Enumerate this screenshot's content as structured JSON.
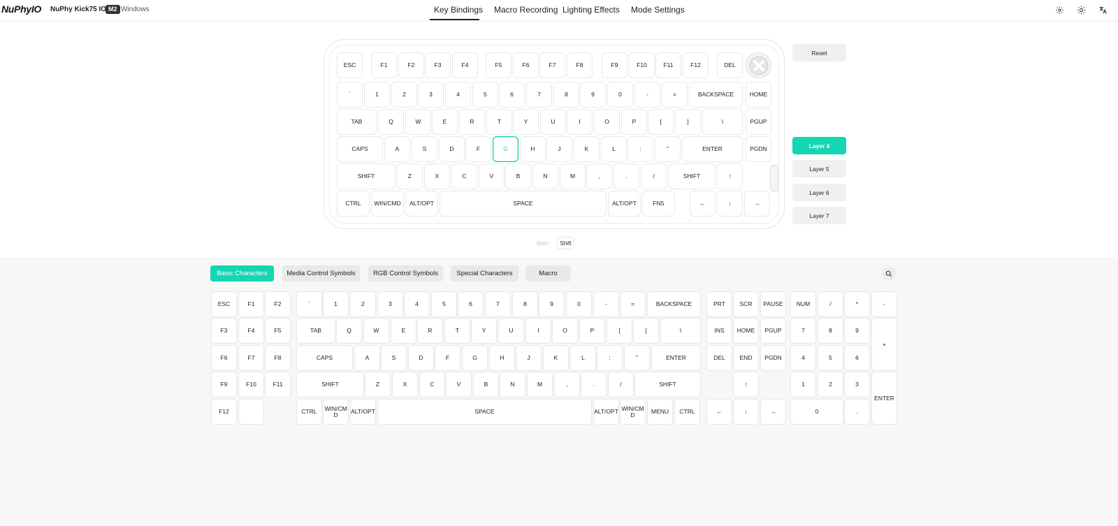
{
  "header": {
    "logo": "NuPhyIO",
    "device": "NuPhy Kick75 IO",
    "mode_badge": "M2",
    "os": "Windows",
    "tabs": [
      "Key Bindings",
      "Macro Recording",
      "Lighting Effects",
      "Mode Settings"
    ],
    "active_tab": "Key Bindings",
    "icons": [
      "gear-icon",
      "sun-icon",
      "translate-icon"
    ]
  },
  "keyboard": {
    "selected_key": "G",
    "row0": [
      "ESC",
      "F1",
      "F2",
      "F3",
      "F4",
      "F5",
      "F6",
      "F7",
      "F8",
      "F9",
      "F10",
      "F11",
      "F12",
      "DEL"
    ],
    "row1": [
      "`",
      "1",
      "2",
      "3",
      "4",
      "5",
      "6",
      "7",
      "8",
      "9",
      "0",
      "-",
      "=",
      "BACKSPACE",
      "HOME"
    ],
    "row2": [
      "TAB",
      "Q",
      "W",
      "E",
      "R",
      "T",
      "Y",
      "U",
      "I",
      "O",
      "P",
      "[",
      "]",
      "\\",
      "PGUP"
    ],
    "row3": [
      "CAPS",
      "A",
      "S",
      "D",
      "F",
      "G",
      "H",
      "J",
      "K",
      "L",
      ":",
      "\"",
      "ENTER",
      "PGDN"
    ],
    "row4": [
      "SHIFT",
      "Z",
      "X",
      "C",
      "V",
      "B",
      "N",
      "M",
      ",",
      ".",
      "/",
      "SHIFT",
      "↑"
    ],
    "row5": [
      "CTRL",
      "WIN/CMD",
      "ALT/OPT",
      "SPACE",
      "ALT/OPT",
      "FN5",
      "←",
      "↓",
      "→"
    ]
  },
  "layers": {
    "reset": "Reset",
    "items": [
      "Layer 4",
      "Layer 5",
      "Layer 6",
      "Layer 7"
    ],
    "active": "Layer 4"
  },
  "sub_toggle": {
    "main": "Main",
    "shift": "Shift"
  },
  "categories": {
    "items": [
      "Basic Characters",
      "Media Control Symbols",
      "RGB Control Symbols",
      "Special Characters",
      "Macro"
    ],
    "active": "Basic Characters"
  },
  "palette": {
    "fkeys": [
      [
        "ESC",
        "F1",
        "F2"
      ],
      [
        "F3",
        "F4",
        "F5"
      ],
      [
        "F6",
        "F7",
        "F8"
      ],
      [
        "F9",
        "F10",
        "F11"
      ],
      [
        "F12",
        ""
      ]
    ],
    "main_r0": [
      "`",
      "1",
      "2",
      "3",
      "4",
      "5",
      "6",
      "7",
      "8",
      "9",
      "0",
      "-",
      "=",
      "BACKSPACE"
    ],
    "main_r1": [
      "TAB",
      "Q",
      "W",
      "E",
      "R",
      "T",
      "Y",
      "U",
      "I",
      "O",
      "P",
      "[",
      "]",
      "\\"
    ],
    "main_r2": [
      "CAPS",
      "A",
      "S",
      "D",
      "F",
      "G",
      "H",
      "J",
      "K",
      "L",
      ":",
      "\"",
      "ENTER"
    ],
    "main_r3": [
      "SHIFT",
      "Z",
      "X",
      "C",
      "V",
      "B",
      "N",
      "M",
      ",",
      ".",
      "/",
      "SHIFT"
    ],
    "main_r4": [
      "CTRL",
      "WIN/CM D",
      "ALT/OPT",
      "SPACE",
      "ALT/OPT",
      "WIN/CM D",
      "MENU",
      "CTRL"
    ],
    "nav_r0": [
      "PRT",
      "SCR",
      "PAUSE"
    ],
    "nav_r1": [
      "INS",
      "HOME",
      "PGUP"
    ],
    "nav_r2": [
      "DEL",
      "END",
      "PGDN"
    ],
    "nav_arrows": [
      "↑",
      "←",
      "↓",
      "→"
    ],
    "numpad": [
      "NUM",
      "/",
      "*",
      "-",
      "7",
      "8",
      "9",
      "+",
      "4",
      "5",
      "6",
      "1",
      "2",
      "3",
      "ENTER",
      "0",
      "."
    ]
  }
}
